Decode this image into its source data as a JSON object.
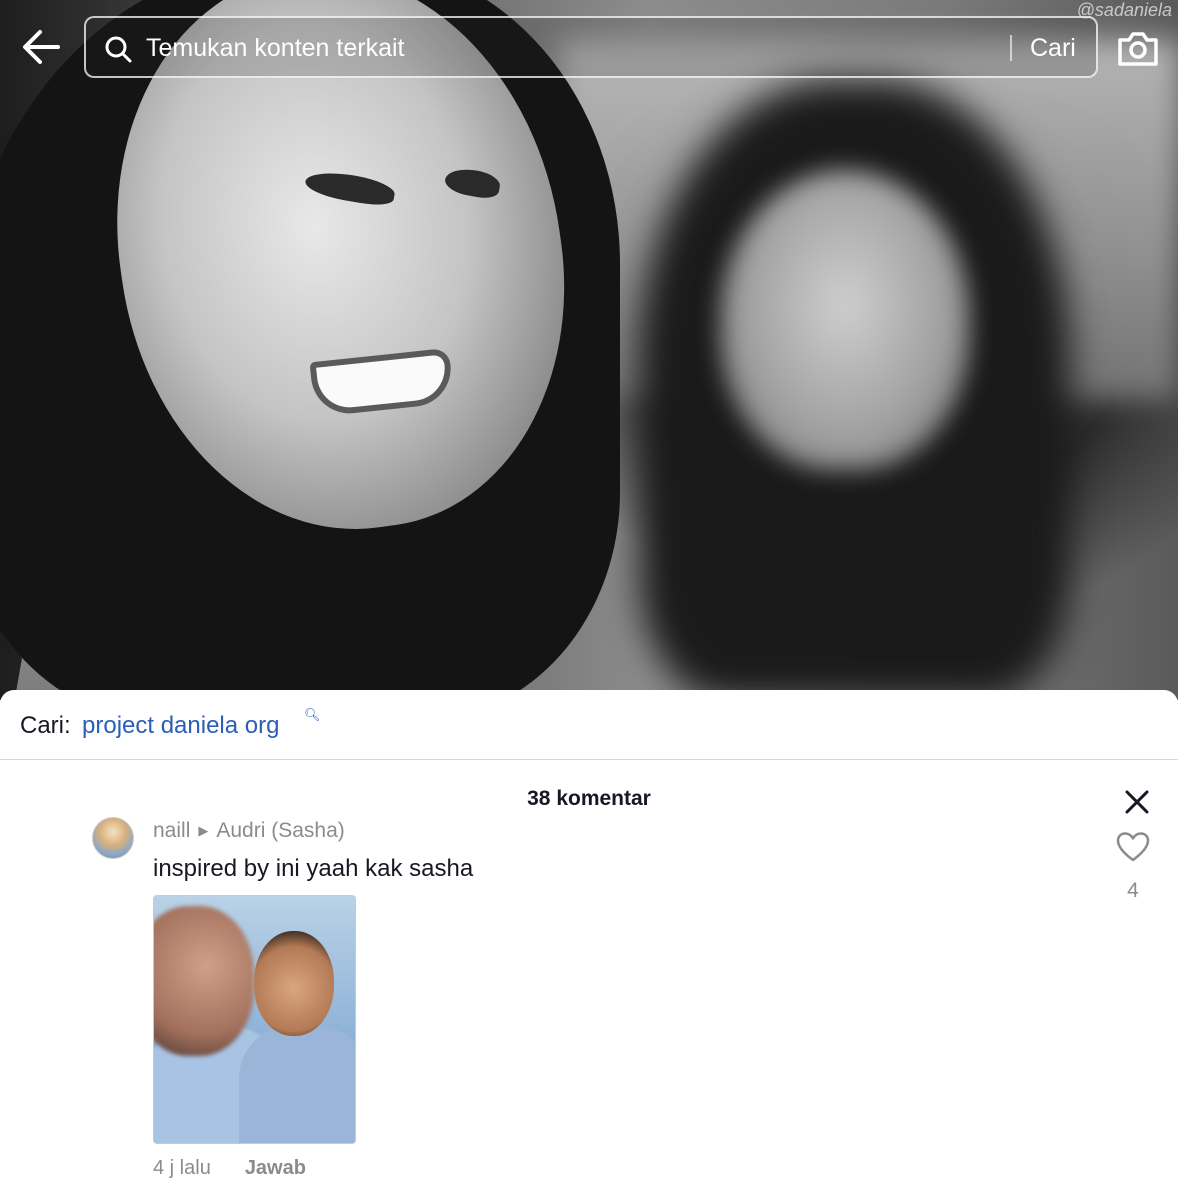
{
  "search": {
    "placeholder": "Temukan konten terkait",
    "submit_label": "Cari"
  },
  "video": {
    "watermark": "@sadaniela"
  },
  "related_search": {
    "label": "Cari:",
    "query": "project daniela org"
  },
  "comments": {
    "count_label": "38 komentar",
    "items": [
      {
        "author": "naill",
        "reply_to": "Audri (Sasha)",
        "text": "inspired by ini yaah kak sasha",
        "time": "4 j lalu",
        "reply_label": "Jawab",
        "likes": "4"
      }
    ]
  },
  "icons": {
    "back": "arrow-left-icon",
    "search": "search-icon",
    "camera": "camera-icon",
    "close": "close-icon",
    "like": "heart-outline-icon",
    "related_search": "search-icon"
  },
  "colors": {
    "link_blue": "#2b5db9",
    "muted_text": "#8a8b91",
    "primary_text": "#161823"
  }
}
